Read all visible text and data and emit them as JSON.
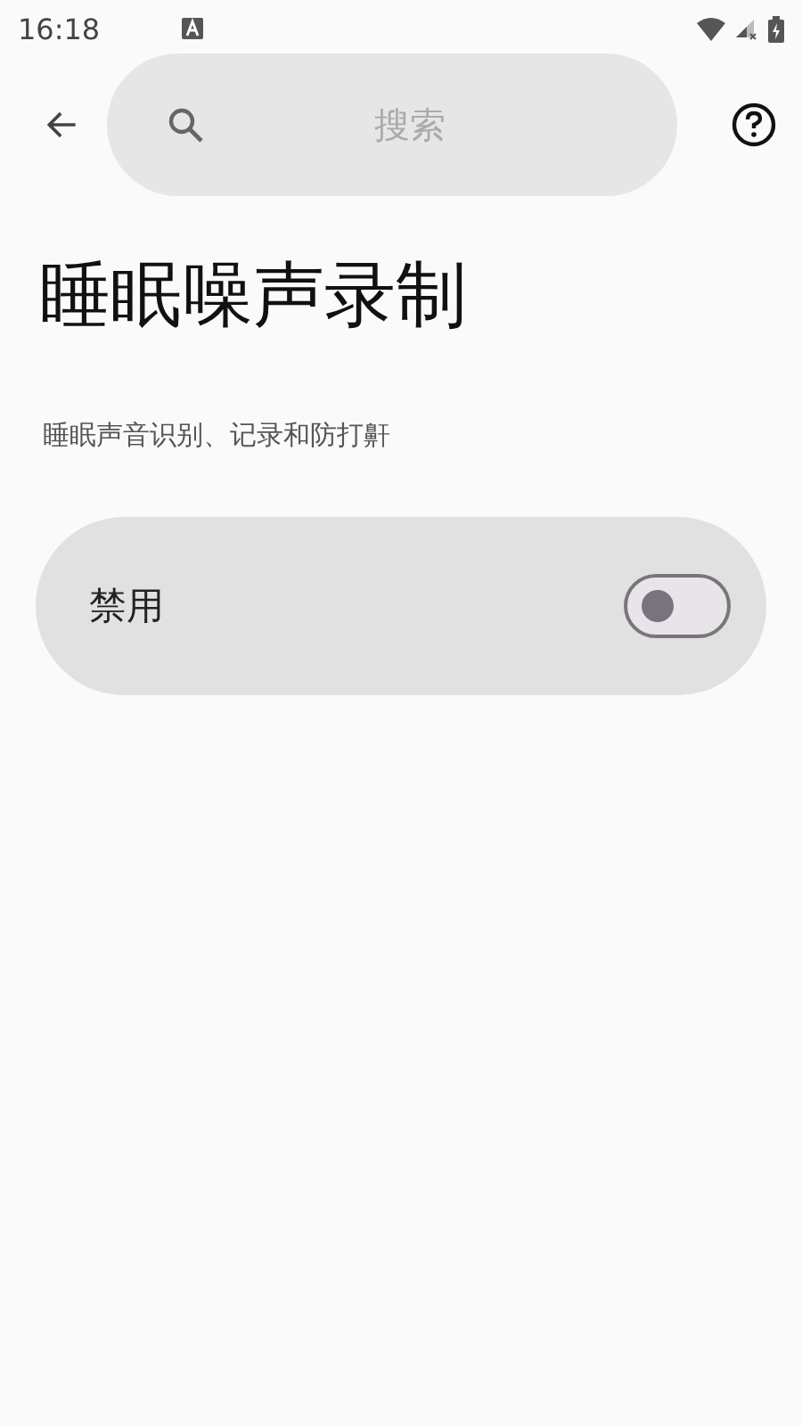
{
  "status_bar": {
    "time": "16:18"
  },
  "search": {
    "placeholder": "搜索"
  },
  "title": "睡眠噪声录制",
  "subtitle": "睡眠声音识别、记录和防打鼾",
  "main_switch": {
    "label": "禁用",
    "on": false
  }
}
